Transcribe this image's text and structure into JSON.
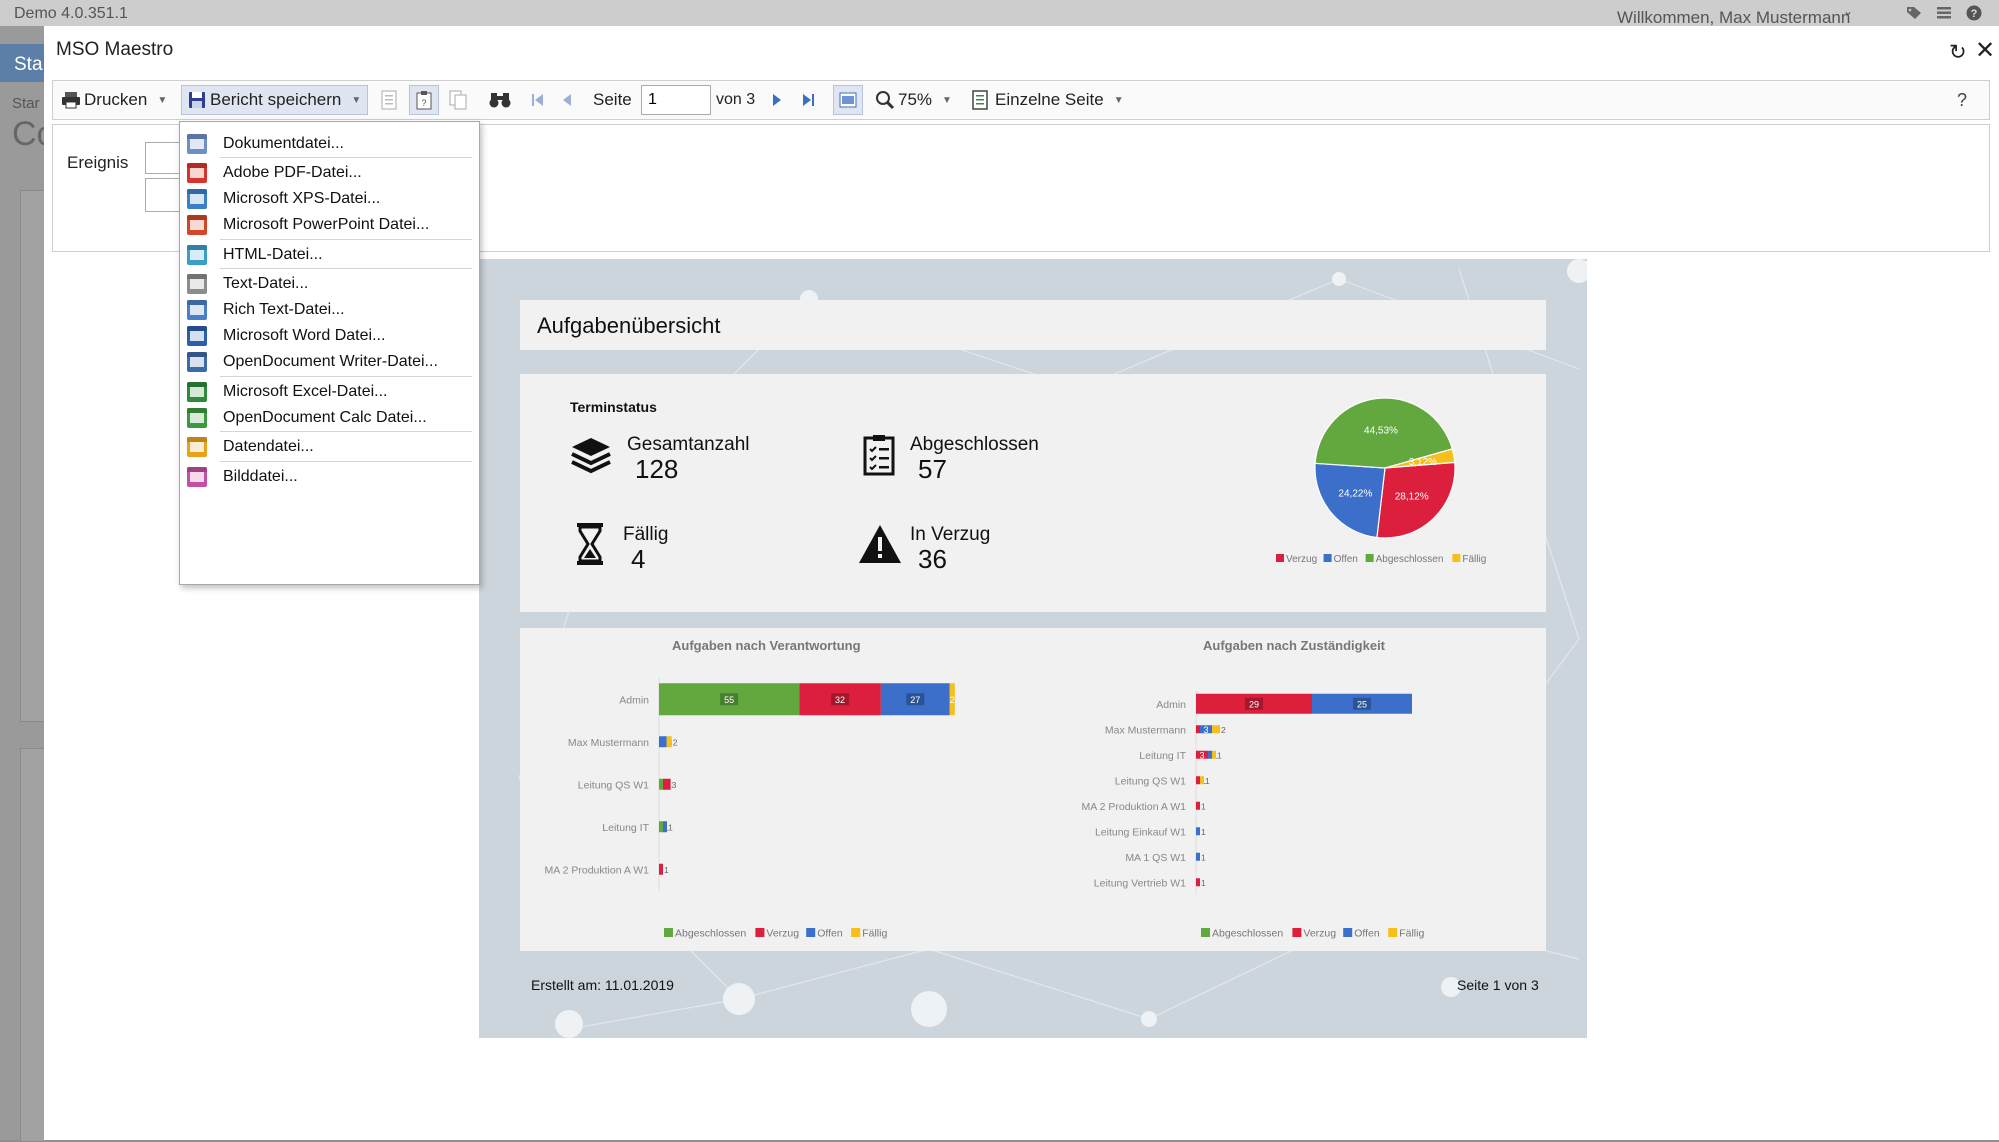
{
  "app": {
    "version": "Demo 4.0.351.1",
    "welcome": "Willkommen, Max Mustermann",
    "bg_tab": "Sta",
    "bg_text1": "Star",
    "bg_text2": "Co"
  },
  "dialog": {
    "title": "MSO Maestro"
  },
  "toolbar": {
    "print": "Drucken",
    "save_report": "Bericht speichern",
    "page_label": "Seite",
    "page_value": "1",
    "page_of": "von 3",
    "zoom": "75%",
    "view_mode": "Einzelne Seite",
    "help": "?"
  },
  "params": {
    "event_label": "Ereignis"
  },
  "save_menu": {
    "items": [
      {
        "label": "Dokumentdatei...",
        "color": "#6d8fc7"
      },
      {
        "label": "Adobe PDF-Datei...",
        "color": "#d9342b"
      },
      {
        "label": "Microsoft XPS-Datei...",
        "color": "#3a7fc8"
      },
      {
        "label": "Microsoft PowerPoint Datei...",
        "color": "#d24726"
      },
      {
        "label": "HTML-Datei...",
        "color": "#3b9ec9"
      },
      {
        "label": "Text-Datei...",
        "color": "#8c8c8c"
      },
      {
        "label": "Rich Text-Datei...",
        "color": "#4a7ec6"
      },
      {
        "label": "Microsoft Word Datei...",
        "color": "#2b5fae"
      },
      {
        "label": "OpenDocument Writer-Datei...",
        "color": "#3d6aa8"
      },
      {
        "label": "Microsoft Excel-Datei...",
        "color": "#2f8a3c"
      },
      {
        "label": "OpenDocument Calc Datei...",
        "color": "#3b9a3e"
      },
      {
        "label": "Datendatei...",
        "color": "#e8a21a"
      },
      {
        "label": "Bilddatei...",
        "color": "#c54fa3"
      }
    ]
  },
  "report": {
    "title": "Aufgabenübersicht",
    "status_heading": "Terminstatus",
    "kpis": [
      {
        "label": "Gesamtanzahl",
        "value": "128",
        "icon": "stack-icon"
      },
      {
        "label": "Abgeschlossen",
        "value": "57",
        "icon": "checklist-icon"
      },
      {
        "label": "Fällig",
        "value": "4",
        "icon": "hourglass-icon"
      },
      {
        "label": "In Verzug",
        "value": "36",
        "icon": "warning-icon"
      }
    ],
    "footer_created": "Erstellt am: 11.01.2019",
    "footer_page": "Seite 1 von 3"
  },
  "colors": {
    "verzug": "#dc1f3c",
    "offen": "#3b6fc9",
    "abgeschlossen": "#62a83e",
    "faellig": "#f5bf1c"
  },
  "chart_data": [
    {
      "type": "pie",
      "title": "",
      "labels": [
        "Verzug",
        "Offen",
        "Abgeschlossen",
        "Fällig"
      ],
      "values": [
        28.12,
        24.22,
        44.53,
        3.12
      ],
      "value_labels": [
        "28,12%",
        "24,22%",
        "44,53%",
        "3,12%"
      ],
      "legend": "bottom"
    },
    {
      "type": "bar",
      "orientation": "horizontal",
      "stacked": true,
      "title": "Aufgaben nach Verantwortung",
      "categories": [
        "Admin",
        "Max Mustermann",
        "Leitung QS W1",
        "Leitung IT",
        "MA 2 Produktion A W1"
      ],
      "series": [
        {
          "name": "Abgeschlossen",
          "values": [
            55,
            0,
            1,
            1,
            0
          ]
        },
        {
          "name": "Verzug",
          "values": [
            32,
            0,
            3,
            0,
            1
          ]
        },
        {
          "name": "Offen",
          "values": [
            27,
            3,
            0,
            1,
            0
          ]
        },
        {
          "name": "Fällig",
          "values": [
            2,
            2,
            0,
            0,
            0
          ]
        }
      ],
      "legend": "bottom"
    },
    {
      "type": "bar",
      "orientation": "horizontal",
      "stacked": true,
      "title": "Aufgaben nach Zuständigkeit",
      "categories": [
        "Admin",
        "Max Mustermann",
        "Leitung IT",
        "Leitung QS W1",
        "MA 2 Produktion A W1",
        "Leitung Einkauf W1",
        "MA 1 QS W1",
        "Leitung Vertrieb W1"
      ],
      "series": [
        {
          "name": "Abgeschlossen",
          "values": [
            0,
            0,
            0,
            0,
            0,
            0,
            0,
            0
          ]
        },
        {
          "name": "Verzug",
          "values": [
            29,
            1,
            3,
            1,
            1,
            0,
            0,
            1
          ]
        },
        {
          "name": "Offen",
          "values": [
            25,
            3,
            1,
            0,
            0,
            1,
            1,
            0
          ]
        },
        {
          "name": "Fällig",
          "values": [
            0,
            2,
            1,
            1,
            0,
            0,
            0,
            0
          ]
        }
      ],
      "legend": "bottom"
    }
  ]
}
